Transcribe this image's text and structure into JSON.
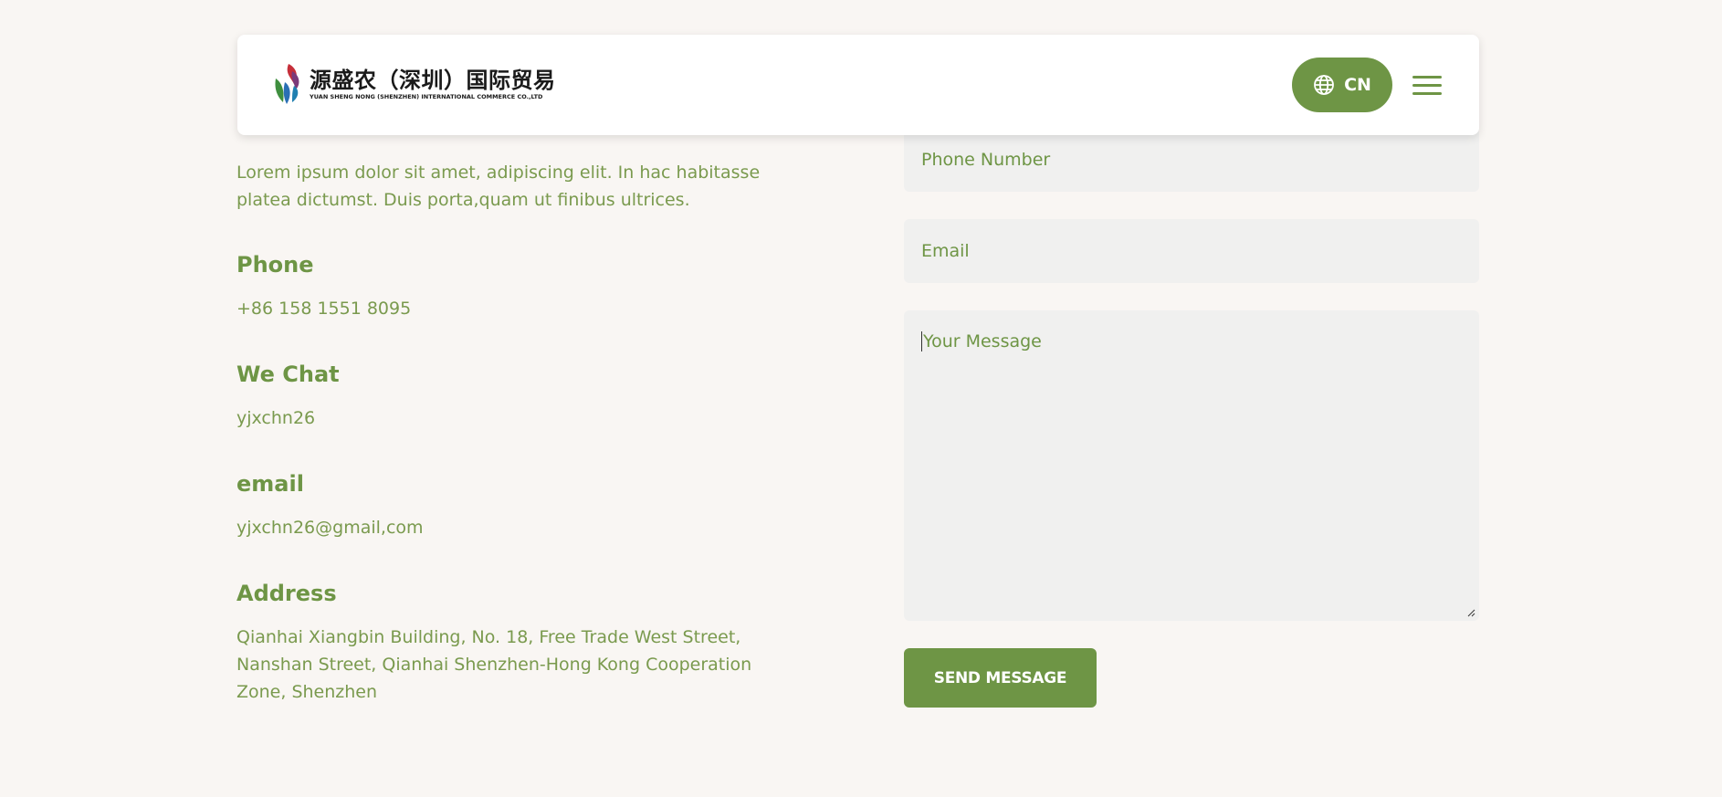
{
  "header": {
    "logo_cn": "源盛农（深圳）国际贸易",
    "logo_en": "YUAN SHENG NONG (SHENZHEN) INTERNATIONAL COMMERCE CO.,LTD",
    "lang_label": "CN",
    "lang_icon": "globe-icon",
    "menu_icon": "hamburger-menu-icon"
  },
  "contact": {
    "intro": "Lorem ipsum dolor sit amet, adipiscing elit. In hac habitasse platea dictumst. Duis porta,quam ut finibus ultrices.",
    "phone_label": "Phone",
    "phone_value": "+86 158 1551 8095",
    "wechat_label": "We Chat",
    "wechat_value": "yjxchn26",
    "email_label": "email",
    "email_value": "yjxchn26@gmail,com",
    "address_label": "Address",
    "address_value": "Qianhai Xiangbin Building, No. 18, Free Trade West Street, Nanshan Street, Qianhai Shenzhen-Hong Kong Cooperation Zone, Shenzhen"
  },
  "form": {
    "phone_placeholder": "Phone Number",
    "email_placeholder": "Email",
    "message_placeholder": "Your Message",
    "submit_label": "SEND MESSAGE"
  },
  "colors": {
    "accent": "#6e9545",
    "background": "#f9f6f3",
    "field_background": "#f0f0ef"
  }
}
